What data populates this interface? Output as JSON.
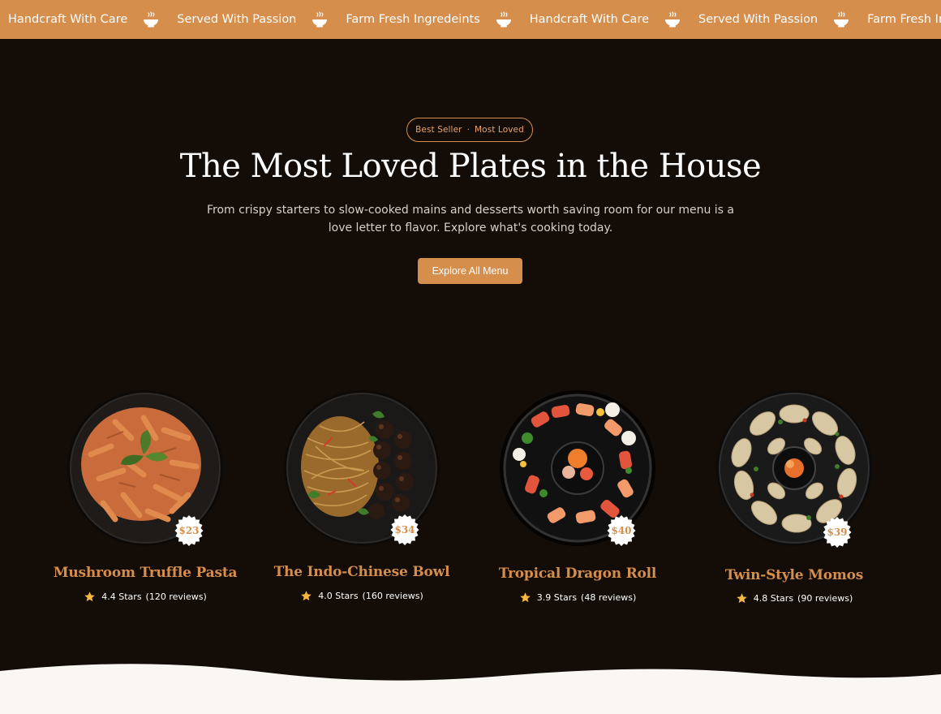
{
  "marquee": {
    "items": [
      "Handcraft With Care",
      "Served With Passion",
      "Farm Fresh Ingredeints",
      "Handcraft With Care",
      "Served With Passion",
      "Farm Fresh Ingredeints"
    ],
    "separator_icon": "bowl-icon"
  },
  "hero": {
    "badge_left": "Best Seller",
    "badge_dot": "·",
    "badge_right": "Most Loved",
    "title": "The Most Loved Plates in the House",
    "description": "From crispy starters to slow-cooked mains and desserts worth saving room for our menu is a love letter to flavor. Explore what's cooking today.",
    "cta_label": "Explore All Menu"
  },
  "dishes": [
    {
      "name": "Mushroom Truffle Pasta",
      "price": "$23",
      "rating": "4.4 Stars",
      "reviews": "(120 reviews)"
    },
    {
      "name": "The Indo-Chinese Bowl",
      "price": "$34",
      "rating": "4.0 Stars",
      "reviews": "(160 reviews)"
    },
    {
      "name": "Tropical Dragon Roll",
      "price": "$40",
      "rating": "3.9 Stars",
      "reviews": "(48 reviews)"
    },
    {
      "name": "Twin-Style Momos",
      "price": "$39",
      "rating": "4.8 Stars",
      "reviews": "(90 reviews)"
    }
  ],
  "colors": {
    "accent": "#d58e4c",
    "background": "#140d07",
    "star": "#f4b740",
    "footer": "#faf7f2"
  }
}
